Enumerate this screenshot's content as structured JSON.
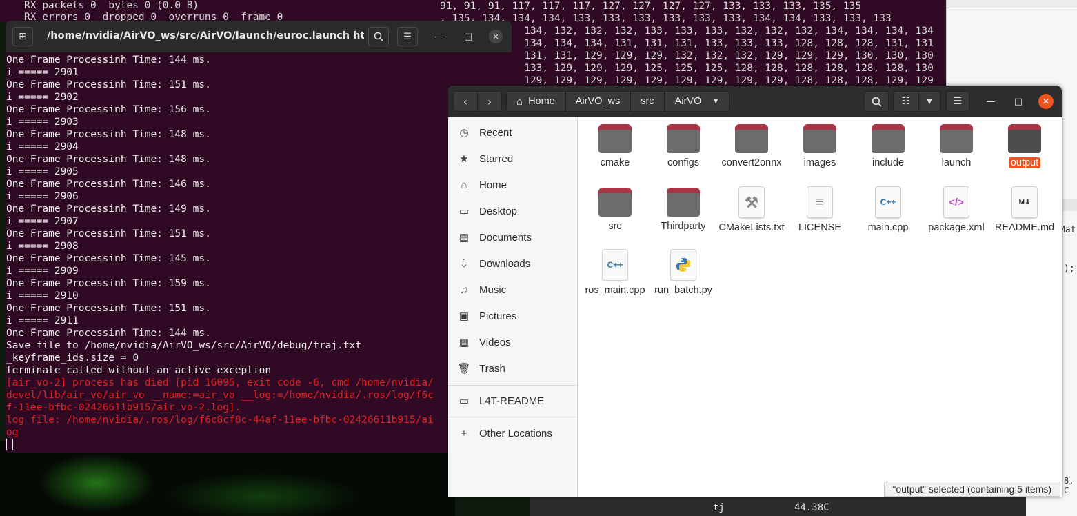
{
  "background": {
    "left_terminal_lines": [
      "RX packets 0  bytes 0 (0.0 B)",
      "RX errors 0  dropped 0  overruns 0  frame 0"
    ],
    "right_terminal_lines": [
      "91, 91, 91, 117, 117, 117, 127, 127, 127, 127, 133, 133, 133, 135, 135",
      ", 135, 134, 134, 134, 133, 133, 133, 133, 133, 133, 134, 134, 133, 133, 133",
      "              134, 132, 132, 132, 133, 133, 133, 132, 132, 132, 134, 134, 134, 134",
      "              134, 134, 134, 131, 131, 131, 133, 133, 133, 128, 128, 128, 131, 131",
      "              131, 131, 129, 129, 129, 132, 132, 132, 129, 129, 129, 130, 130, 130",
      "              133, 129, 129, 129, 125, 125, 125, 128, 128, 128, 128, 128, 128, 130",
      "              129, 129, 129, 129, 129, 129, 129, 129, 129, 128, 128, 128, 129, 129"
    ],
    "right_fragments": [
      "Mat",
      ");",
      "8, C"
    ],
    "bottom_terminal": {
      "label": "tj",
      "value": "44.38C"
    }
  },
  "terminal": {
    "title": "/home/nvidia/AirVO_ws/src/AirVO/launch/euroc.launch http...",
    "lines": [
      "One Frame Processinh Time: 144 ms.",
      "i ===== 2901",
      "One Frame Processinh Time: 151 ms.",
      "i ===== 2902",
      "One Frame Processinh Time: 156 ms.",
      "i ===== 2903",
      "One Frame Processinh Time: 148 ms.",
      "i ===== 2904",
      "One Frame Processinh Time: 148 ms.",
      "i ===== 2905",
      "One Frame Processinh Time: 146 ms.",
      "i ===== 2906",
      "One Frame Processinh Time: 149 ms.",
      "i ===== 2907",
      "One Frame Processinh Time: 151 ms.",
      "i ===== 2908",
      "One Frame Processinh Time: 145 ms.",
      "i ===== 2909",
      "One Frame Processinh Time: 159 ms.",
      "i ===== 2910",
      "One Frame Processinh Time: 151 ms.",
      "i ===== 2911",
      "One Frame Processinh Time: 144 ms.",
      "Save file to /home/nvidia/AirVO_ws/src/AirVO/debug/traj.txt",
      "_keyframe_ids.size = 0",
      "terminate called without an active exception"
    ],
    "error_lines": [
      "[air_vo-2] process has died [pid 16095, exit code -6, cmd /home/nvidia/",
      "devel/lib/air_vo/air_vo __name:=air_vo __log:=/home/nvidia/.ros/log/f6c",
      "f-11ee-bfbc-02426611b915/air_vo-2.log].",
      "log file: /home/nvidia/.ros/log/f6c8cf8c-44af-11ee-bfbc-02426611b915/ai",
      "og"
    ]
  },
  "files": {
    "breadcrumbs": [
      "Home",
      "AirVO_ws",
      "src",
      "AirVO"
    ],
    "sidebar": [
      {
        "label": "Recent",
        "icon": "clock-icon"
      },
      {
        "label": "Starred",
        "icon": "star-icon"
      },
      {
        "label": "Home",
        "icon": "home-icon"
      },
      {
        "label": "Desktop",
        "icon": "desktop-icon"
      },
      {
        "label": "Documents",
        "icon": "document-icon"
      },
      {
        "label": "Downloads",
        "icon": "download-icon"
      },
      {
        "label": "Music",
        "icon": "music-icon"
      },
      {
        "label": "Pictures",
        "icon": "pictures-icon"
      },
      {
        "label": "Videos",
        "icon": "video-icon"
      },
      {
        "label": "Trash",
        "icon": "trash-icon"
      },
      {
        "label": "L4T-README",
        "icon": "drive-icon"
      },
      {
        "label": "Other Locations",
        "icon": "plus-icon"
      }
    ],
    "items": [
      {
        "name": "cmake",
        "type": "folder"
      },
      {
        "name": "configs",
        "type": "folder"
      },
      {
        "name": "convert2onnx",
        "type": "folder"
      },
      {
        "name": "images",
        "type": "folder"
      },
      {
        "name": "include",
        "type": "folder"
      },
      {
        "name": "launch",
        "type": "folder"
      },
      {
        "name": "output",
        "type": "folder",
        "selected": true
      },
      {
        "name": "src",
        "type": "folder"
      },
      {
        "name": "Thirdparty",
        "type": "folder"
      },
      {
        "name": "CMakeLists.txt",
        "type": "cmake"
      },
      {
        "name": "LICENSE",
        "type": "text"
      },
      {
        "name": "main.cpp",
        "type": "cpp"
      },
      {
        "name": "package.xml",
        "type": "xml"
      },
      {
        "name": "README.md",
        "type": "markdown"
      },
      {
        "name": "ros_main.cpp",
        "type": "cpp"
      },
      {
        "name": "run_batch.py",
        "type": "python"
      }
    ],
    "status": "“output” selected  (containing 5 items)",
    "accent_color": "#e95420"
  }
}
